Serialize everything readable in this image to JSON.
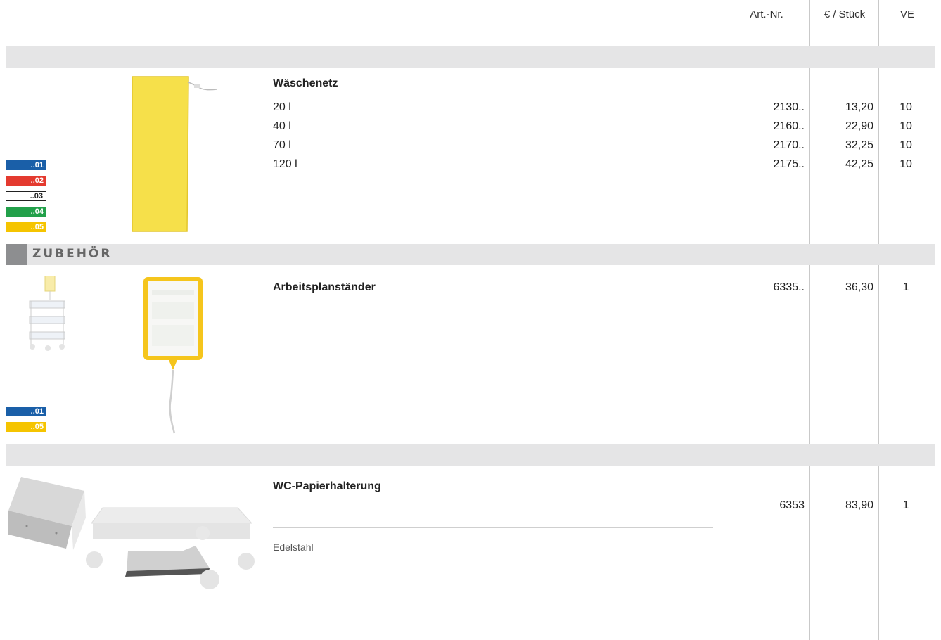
{
  "header": {
    "art_nr": "Art.-Nr.",
    "price": "€ / Stück",
    "ve": "VE"
  },
  "section_label": "ZUBEHÖR",
  "products": [
    {
      "title": "Wäschenetz",
      "variants": [
        {
          "name": "20 l",
          "art": "2130..",
          "price": "13,20",
          "ve": "10"
        },
        {
          "name": "40 l",
          "art": "2160..",
          "price": "22,90",
          "ve": "10"
        },
        {
          "name": "70 l",
          "art": "2170..",
          "price": "32,25",
          "ve": "10"
        },
        {
          "name": "120 l",
          "art": "2175..",
          "price": "42,25",
          "ve": "10"
        }
      ],
      "swatches": [
        {
          "code": "..01",
          "color": "#1a5fa8"
        },
        {
          "code": "..02",
          "color": "#e43a2f"
        },
        {
          "code": "..03",
          "color": "#ffffff"
        },
        {
          "code": "..04",
          "color": "#22a04a"
        },
        {
          "code": "..05",
          "color": "#f5c400"
        }
      ]
    },
    {
      "title": "Arbeitsplanständer",
      "art": "6335..",
      "price": "36,30",
      "ve": "1",
      "swatches": [
        {
          "code": "..01",
          "color": "#1a5fa8"
        },
        {
          "code": "..05",
          "color": "#f5c400"
        }
      ]
    },
    {
      "title": "WC-Papierhalterung",
      "art": "6353",
      "price": "83,90",
      "ve": "1",
      "material": "Edelstahl"
    }
  ]
}
